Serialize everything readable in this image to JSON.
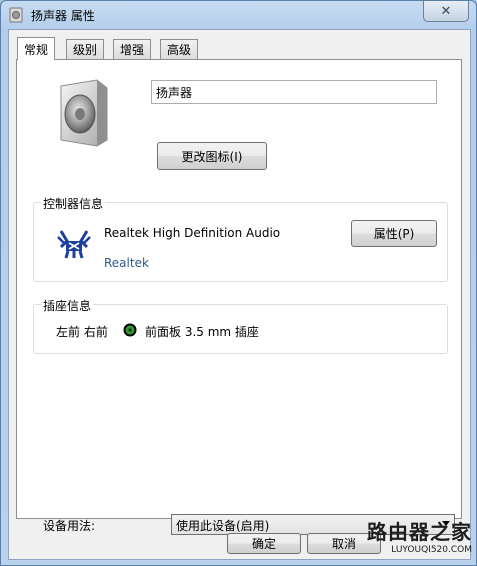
{
  "window": {
    "title": "扬声器 属性",
    "close_glyph": "✕"
  },
  "tabs": [
    {
      "label": "常规",
      "active": true
    },
    {
      "label": "级别",
      "active": false
    },
    {
      "label": "增强",
      "active": false
    },
    {
      "label": "高级",
      "active": false
    }
  ],
  "device": {
    "name": "扬声器",
    "change_icon_button": "更改图标(I)"
  },
  "controller": {
    "group_label": "控制器信息",
    "name": "Realtek High Definition Audio",
    "vendor": "Realtek",
    "properties_button": "属性(P)"
  },
  "jack": {
    "group_label": "插座信息",
    "channels": "左前 右前",
    "location": "前面板 3.5 mm 插座",
    "color": "#2e9b2e"
  },
  "usage": {
    "label": "设备用法:",
    "selected": "使用此设备(启用)"
  },
  "footer": {
    "ok_button": "确定",
    "cancel_button": "取消"
  },
  "watermark": {
    "site_name": "路由器之家",
    "url": "LUYOUQI520.COM"
  }
}
